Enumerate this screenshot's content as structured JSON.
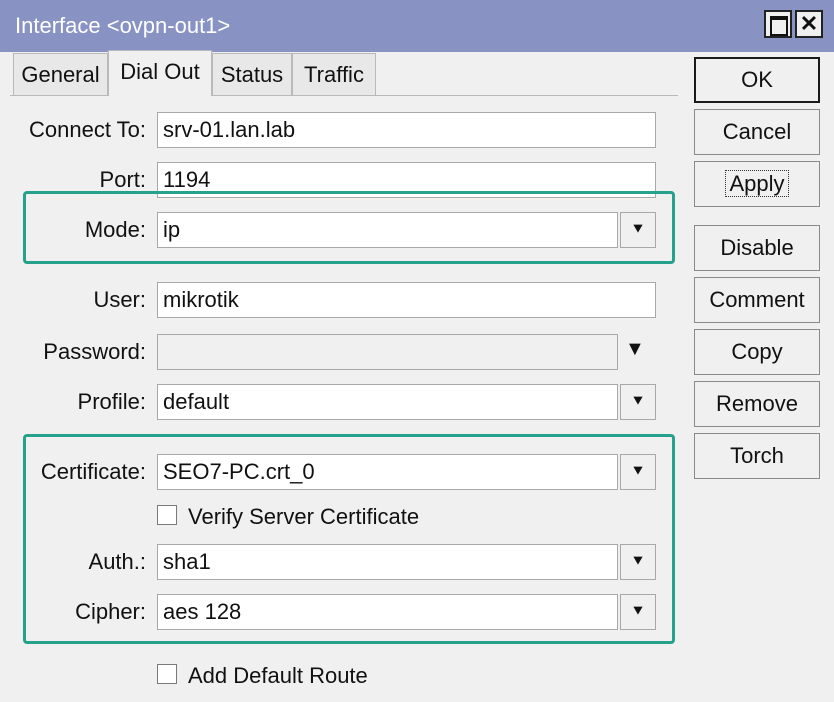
{
  "window": {
    "title": "Interface <ovpn-out1>",
    "close_glyph": "✕"
  },
  "tabs": [
    {
      "label": "General"
    },
    {
      "label": "Dial Out"
    },
    {
      "label": "Status"
    },
    {
      "label": "Traffic"
    }
  ],
  "active_tab": "Dial Out",
  "form": {
    "connect_to": {
      "label": "Connect To:",
      "value": "srv-01.lan.lab"
    },
    "port": {
      "label": "Port:",
      "value": "1194"
    },
    "mode": {
      "label": "Mode:",
      "value": "ip"
    },
    "user": {
      "label": "User:",
      "value": "mikrotik"
    },
    "password": {
      "label": "Password:",
      "value": ""
    },
    "profile": {
      "label": "Profile:",
      "value": "default"
    },
    "certificate": {
      "label": "Certificate:",
      "value": "SEO7-PC.crt_0"
    },
    "verify_server_certificate": {
      "label": "Verify Server Certificate",
      "checked": false
    },
    "auth": {
      "label": "Auth.:",
      "value": "sha1"
    },
    "cipher": {
      "label": "Cipher:",
      "value": "aes 128"
    },
    "add_default_route": {
      "label": "Add Default Route",
      "checked": false
    }
  },
  "icons": {
    "dropdown": "dropdown-arrow-icon",
    "dropdown_glyph": "▼",
    "dropdown_bar_glyph": "⯆"
  },
  "buttons": {
    "ok": "OK",
    "cancel": "Cancel",
    "apply": "Apply",
    "disable": "Disable",
    "comment": "Comment",
    "copy": "Copy",
    "remove": "Remove",
    "torch": "Torch"
  },
  "colors": {
    "titlebar": "#8893c4",
    "highlight": "#26a28c"
  }
}
